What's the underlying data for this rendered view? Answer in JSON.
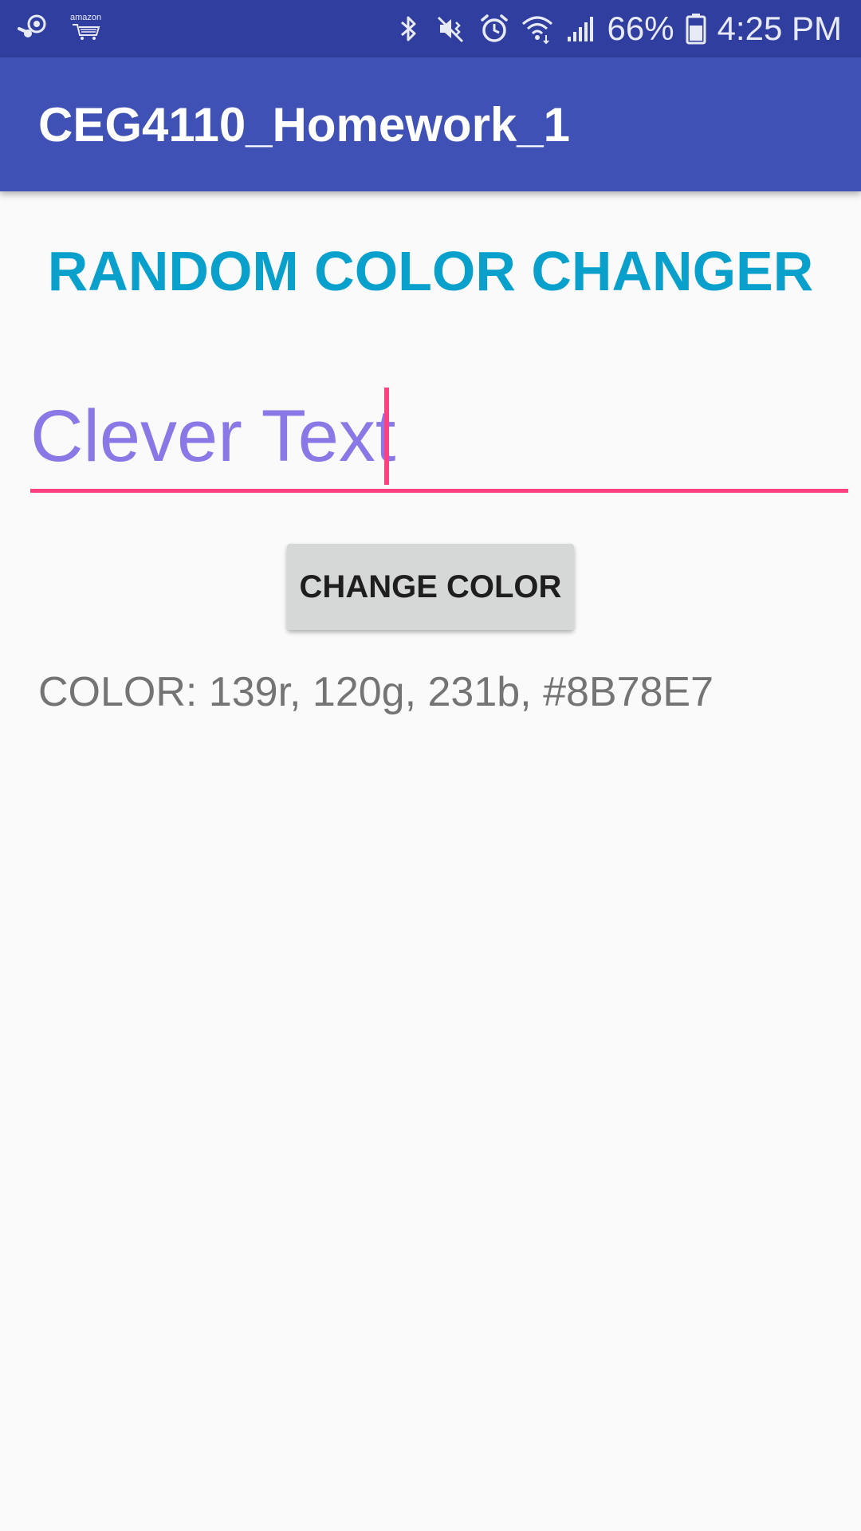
{
  "status_bar": {
    "left_icons": [
      "steam-icon",
      "amazon-cart-icon"
    ],
    "amazon_label": "amazon",
    "right_icons": [
      "bluetooth-icon",
      "mute-vibrate-icon",
      "alarm-icon",
      "wifi-icon",
      "signal-icon",
      "battery-icon"
    ],
    "battery_percent": "66%",
    "time": "4:25 PM",
    "background_color": "#303f9f"
  },
  "app_bar": {
    "title": "CEG4110_Homework_1",
    "background_color": "#3f51b5"
  },
  "main": {
    "heading": "RANDOM COLOR CHANGER",
    "heading_color": "#0aa0cc",
    "text_field": {
      "value": "Clever Text",
      "text_color": "#8b78e7",
      "accent_color": "#ff4081"
    },
    "change_button_label": "CHANGE COLOR",
    "color_readout": "COLOR: 139r, 120g, 231b, #8B78E7"
  }
}
